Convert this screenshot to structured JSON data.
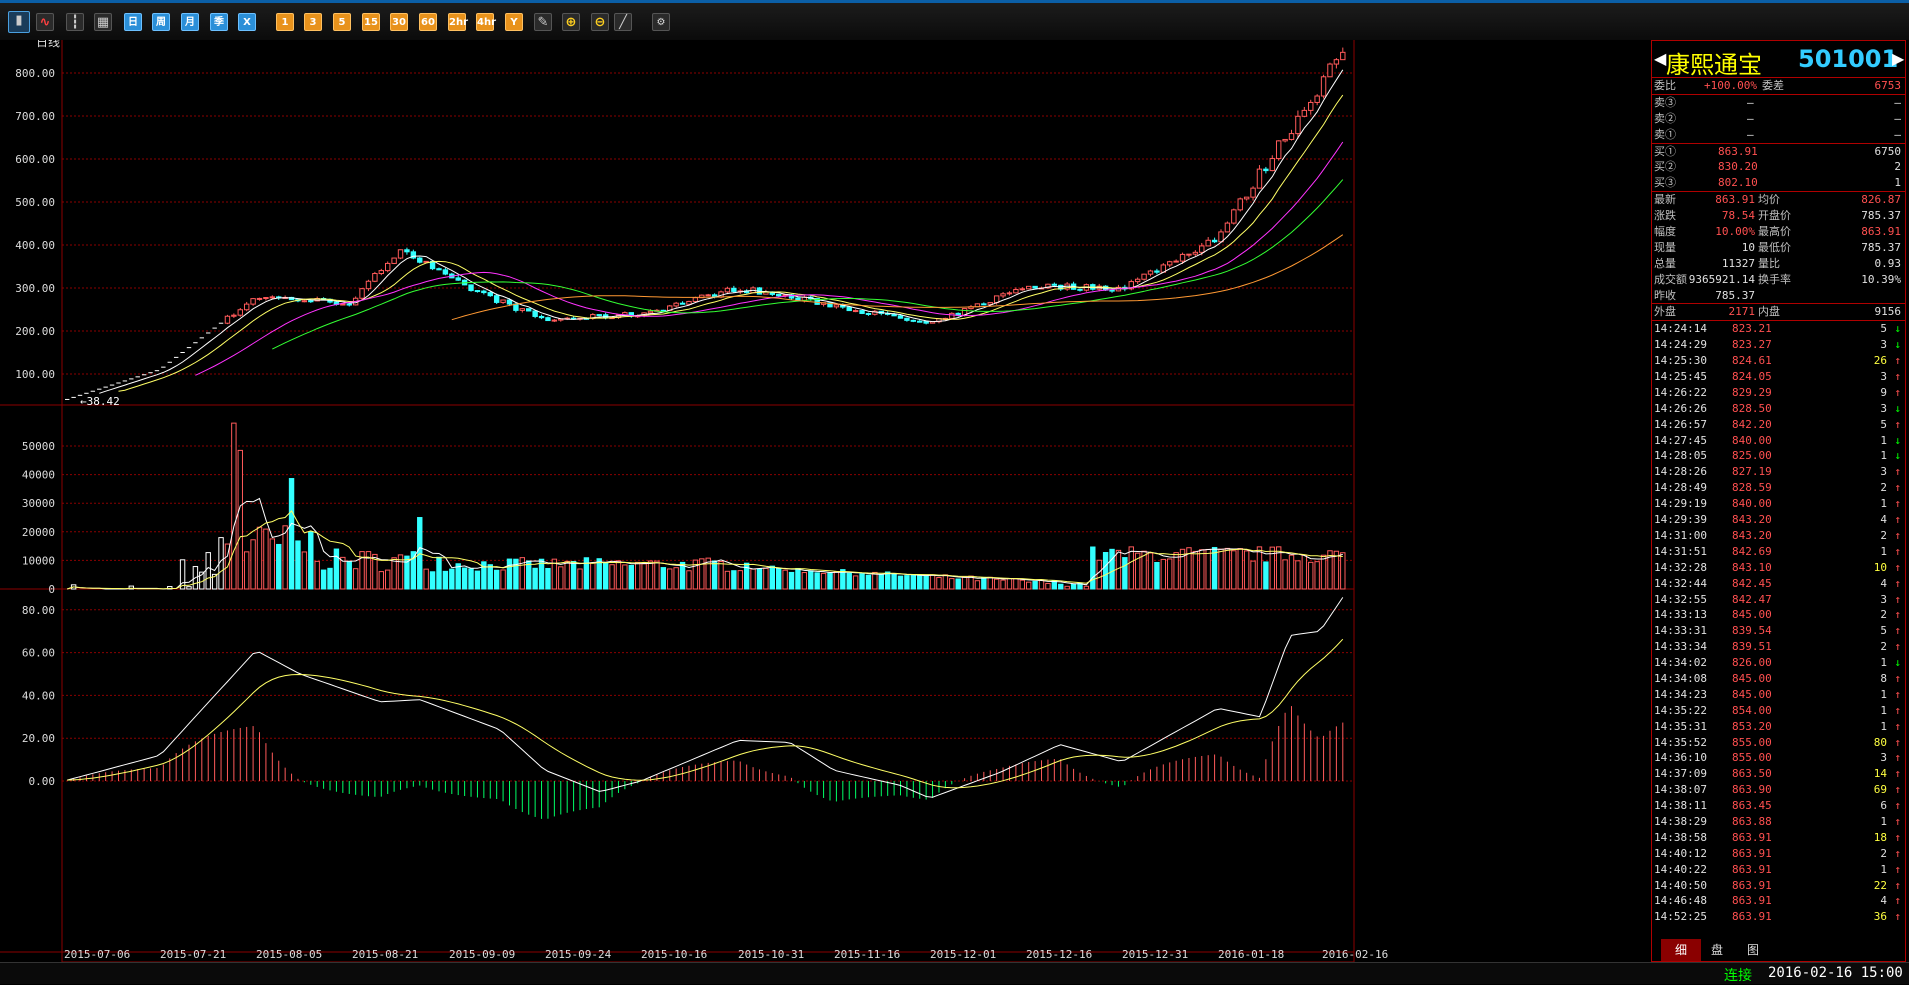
{
  "toolbar": {
    "buttons": [
      {
        "icon": "candlestick-icon",
        "label": ""
      },
      {
        "icon": "line-chart-icon",
        "label": ""
      },
      {
        "icon": "multi-candle-icon",
        "label": ""
      },
      {
        "icon": "calendar-icon",
        "label": ""
      },
      {
        "icon": "day-icon",
        "label": "日"
      },
      {
        "icon": "week-icon",
        "label": "周"
      },
      {
        "icon": "month-icon",
        "label": "月"
      },
      {
        "icon": "season-icon",
        "label": "季"
      },
      {
        "icon": "x-icon",
        "label": "X"
      },
      {
        "icon": "min1-icon",
        "label": "1"
      },
      {
        "icon": "min3-icon",
        "label": "3"
      },
      {
        "icon": "min5-icon",
        "label": "5"
      },
      {
        "icon": "min15-icon",
        "label": "15"
      },
      {
        "icon": "min30-icon",
        "label": "30"
      },
      {
        "icon": "min60-icon",
        "label": "60"
      },
      {
        "icon": "hour2-icon",
        "label": "2hr"
      },
      {
        "icon": "hour4-icon",
        "label": "4hr"
      },
      {
        "icon": "year-icon",
        "label": "Y"
      },
      {
        "icon": "notes-icon",
        "label": ""
      },
      {
        "icon": "zoom-in-icon",
        "label": ""
      },
      {
        "icon": "zoom-out-icon",
        "label": ""
      },
      {
        "icon": "draw-icon",
        "label": ""
      },
      {
        "icon": "gear-icon",
        "label": "⚙"
      }
    ]
  },
  "chart": {
    "period_label": "日线",
    "min_label": "38.42",
    "y_ticks": [
      "800.00",
      "700.00",
      "600.00",
      "500.00",
      "400.00",
      "300.00",
      "200.00",
      "100.00"
    ],
    "vol_ticks": [
      "50000",
      "40000",
      "30000",
      "20000",
      "10000",
      "0"
    ],
    "macd_ticks": [
      "80.00",
      "60.00",
      "40.00",
      "20.00",
      "0.00"
    ],
    "x_dates": [
      "2015-07-06",
      "2015-07-21",
      "2015-08-05",
      "2015-08-21",
      "2015-09-09",
      "2015-09-24",
      "2015-10-16",
      "2015-10-31",
      "2015-11-16",
      "2015-12-01",
      "2015-12-16",
      "2015-12-31",
      "2016-01-18",
      "2016-02-16"
    ],
    "colors": {
      "up": "#ff5a5a",
      "down": "#33ffff",
      "grid": "#8b0000",
      "ma5": "#ffffff",
      "ma10": "#ffff66",
      "ma20": "#ff33ff",
      "ma30": "#33ff33",
      "ma60": "#ff9933"
    }
  },
  "chart_data": {
    "type": "candlestick",
    "price_ylim": [
      38.42,
      863.91
    ],
    "price_path": [
      [
        "2015-07-06",
        38.42
      ],
      [
        "2015-07-21",
        110
      ],
      [
        "2015-08-05",
        280
      ],
      [
        "2015-08-21",
        265
      ],
      [
        "2015-08-28",
        395
      ],
      [
        "2015-09-09",
        320
      ],
      [
        "2015-09-24",
        225
      ],
      [
        "2015-10-16",
        240
      ],
      [
        "2015-10-31",
        300
      ],
      [
        "2015-11-16",
        260
      ],
      [
        "2015-12-01",
        215
      ],
      [
        "2015-12-16",
        305
      ],
      [
        "2015-12-31",
        300
      ],
      [
        "2016-01-18",
        420
      ],
      [
        "2016-02-16",
        863.91
      ]
    ],
    "volume_peak": 58000,
    "macd_peaks": [
      [
        "2015-08-05",
        61
      ],
      [
        "2015-10-31",
        19
      ],
      [
        "2016-02-16",
        88
      ]
    ]
  },
  "quote": {
    "name": "康熙通宝",
    "code": "501001",
    "weibi_label": "委比",
    "weibi_value": "+100.00%",
    "weicha_label": "委差",
    "weicha_value": "6753",
    "asks": [
      {
        "label": "卖③",
        "price": "—",
        "vol": "—"
      },
      {
        "label": "卖②",
        "price": "—",
        "vol": "—"
      },
      {
        "label": "卖①",
        "price": "—",
        "vol": "—"
      }
    ],
    "bids": [
      {
        "label": "买①",
        "price": "863.91",
        "vol": "6750"
      },
      {
        "label": "买②",
        "price": "830.20",
        "vol": "2"
      },
      {
        "label": "买③",
        "price": "802.10",
        "vol": "1"
      }
    ],
    "stats": [
      {
        "l1": "最新",
        "v1": "863.91",
        "l2": "均价",
        "v2": "826.87"
      },
      {
        "l1": "涨跌",
        "v1": "78.54",
        "l2": "开盘价",
        "v2": "785.37"
      },
      {
        "l1": "幅度",
        "v1": "10.00%",
        "l2": "最高价",
        "v2": "863.91"
      },
      {
        "l1": "现量",
        "v1": "10",
        "l2": "最低价",
        "v2": "785.37"
      },
      {
        "l1": "总量",
        "v1": "11327",
        "l2": "量比",
        "v2": "0.93"
      },
      {
        "l1": "成交额",
        "v1": "9365921.14",
        "l2": "换手率",
        "v2": "10.39%"
      }
    ],
    "prev_close_label": "昨收",
    "prev_close": "785.37",
    "outer_label": "外盘",
    "outer": "2171",
    "inner_label": "内盘",
    "inner": "9156",
    "ticks": [
      [
        "14:24:14",
        "823.21",
        "5",
        "↓"
      ],
      [
        "14:24:29",
        "823.27",
        "3",
        "↓"
      ],
      [
        "14:25:30",
        "824.61",
        "26",
        "↑"
      ],
      [
        "14:25:45",
        "824.05",
        "3",
        "↑"
      ],
      [
        "14:26:22",
        "829.29",
        "9",
        "↑"
      ],
      [
        "14:26:26",
        "828.50",
        "3",
        "↓"
      ],
      [
        "14:26:57",
        "842.20",
        "5",
        "↑"
      ],
      [
        "14:27:45",
        "840.00",
        "1",
        "↓"
      ],
      [
        "14:28:05",
        "825.00",
        "1",
        "↓"
      ],
      [
        "14:28:26",
        "827.19",
        "3",
        "↑"
      ],
      [
        "14:28:49",
        "828.59",
        "2",
        "↑"
      ],
      [
        "14:29:19",
        "840.00",
        "1",
        "↑"
      ],
      [
        "14:29:39",
        "843.20",
        "4",
        "↑"
      ],
      [
        "14:31:00",
        "843.20",
        "2",
        "↑"
      ],
      [
        "14:31:51",
        "842.69",
        "1",
        "↑"
      ],
      [
        "14:32:28",
        "843.10",
        "10",
        "↑"
      ],
      [
        "14:32:44",
        "842.45",
        "4",
        "↑"
      ],
      [
        "14:32:55",
        "842.47",
        "3",
        "↑"
      ],
      [
        "14:33:13",
        "845.00",
        "2",
        "↑"
      ],
      [
        "14:33:31",
        "839.54",
        "5",
        "↑"
      ],
      [
        "14:33:34",
        "839.51",
        "2",
        "↑"
      ],
      [
        "14:34:02",
        "826.00",
        "1",
        "↓"
      ],
      [
        "14:34:08",
        "845.00",
        "8",
        "↑"
      ],
      [
        "14:34:23",
        "845.00",
        "1",
        "↑"
      ],
      [
        "14:35:22",
        "854.00",
        "1",
        "↑"
      ],
      [
        "14:35:31",
        "853.20",
        "1",
        "↑"
      ],
      [
        "14:35:52",
        "855.00",
        "80",
        "↑"
      ],
      [
        "14:36:10",
        "855.00",
        "3",
        "↑"
      ],
      [
        "14:37:09",
        "863.50",
        "14",
        "↑"
      ],
      [
        "14:38:07",
        "863.90",
        "69",
        "↑"
      ],
      [
        "14:38:11",
        "863.45",
        "6",
        "↑"
      ],
      [
        "14:38:29",
        "863.88",
        "1",
        "↑"
      ],
      [
        "14:38:58",
        "863.91",
        "18",
        "↑"
      ],
      [
        "14:40:12",
        "863.91",
        "2",
        "↑"
      ],
      [
        "14:40:22",
        "863.91",
        "1",
        "↑"
      ],
      [
        "14:40:50",
        "863.91",
        "22",
        "↑"
      ],
      [
        "14:46:48",
        "863.91",
        "4",
        "↑"
      ],
      [
        "14:52:25",
        "863.91",
        "36",
        "↑"
      ]
    ],
    "tabs": [
      "细",
      "盘",
      "图"
    ]
  },
  "status": {
    "connection": "连接",
    "datetime": "2016-02-16 15:00"
  }
}
